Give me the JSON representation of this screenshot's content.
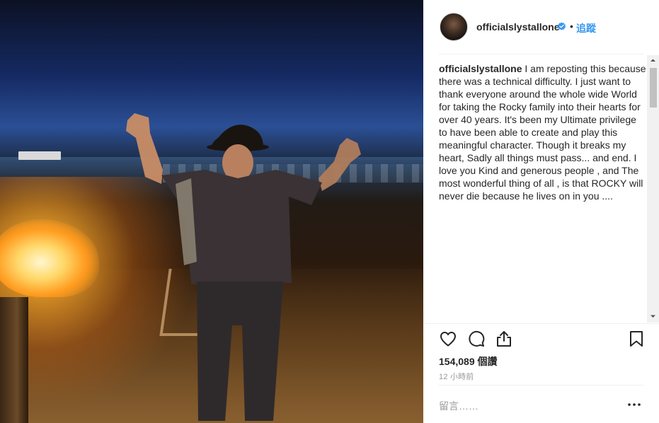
{
  "post": {
    "username": "officialslystallone",
    "follow_label": "追蹤",
    "separator": "•",
    "caption_user": "officialslystallone",
    "caption_text": "I am reposting this because there was a technical difficulty. I just want to thank everyone around the whole wide World for taking the Rocky family into their hearts for over 40 years. It's been my Ultimate privilege to have been able to create and play this meaningful character. Though it breaks my heart, Sadly all things must pass... and end. I love you Kind and generous people , and The most wonderful thing of all , is that ROCKY will never die because he lives on in you ....",
    "views": "154,089 個讚",
    "timestamp": "12 小時前",
    "comment_placeholder": "留言……"
  },
  "icons": {
    "verified": "verified-badge-icon",
    "like": "heart-icon",
    "comment": "comment-bubble-icon",
    "share": "share-icon",
    "save": "bookmark-icon",
    "more": "more-options-icon"
  },
  "colors": {
    "link_blue": "#3897f0",
    "text": "#262626",
    "muted": "#999999",
    "divider": "#efefef"
  }
}
